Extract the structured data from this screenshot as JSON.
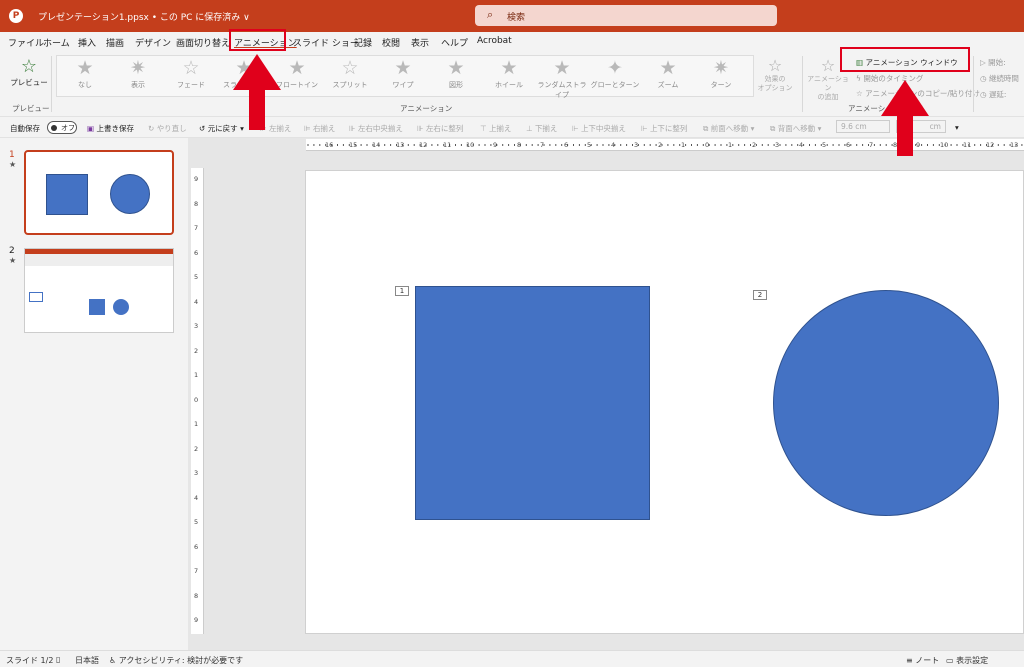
{
  "titlebar": {
    "filename": "プレゼンテーション1.ppsx • この PC に保存済み ∨",
    "search_placeholder": "検索"
  },
  "tabs": [
    "ファイル",
    "ホーム",
    "挿入",
    "描画",
    "デザイン",
    "画面切り替え",
    "アニメーション",
    "スライド ショー",
    "記録",
    "校閲",
    "表示",
    "ヘルプ",
    "Acrobat"
  ],
  "active_tab": "アニメーション",
  "ribbon": {
    "preview_button": "プレビュー",
    "preview_group": "プレビュー",
    "animation_group": "アニメーション",
    "advanced_group": "アニメーションの設定",
    "animations": [
      "なし",
      "表示",
      "フェード",
      "スライドイン",
      "フロートイン",
      "スプリット",
      "ワイプ",
      "図形",
      "ホイール",
      "ランダムストライプ",
      "グローとターン",
      "ズーム",
      "ターン"
    ],
    "effect_options": "効果の\nオプション",
    "add_animation": "アニメーション\nの追加",
    "animation_window": "アニメーション ウィンドウ",
    "trigger": "開始のタイミング",
    "animation_painter": "アニメーションのコピー/貼り付け",
    "start_label": "開始:",
    "duration_label": "継続時間",
    "delay_label": "遅延:"
  },
  "qat": {
    "autosave": "自動保存",
    "autosave_state": "オフ",
    "save": "上書き保存",
    "undo": "やり直し",
    "redo": "元に戻す",
    "align_left": "左揃え",
    "align_right": "右揃え",
    "align_center_h": "左右中央揃え",
    "distribute_h": "左右に整列",
    "align_top": "上揃え",
    "align_bottom": "下揃え",
    "align_center_v": "上下中央揃え",
    "distribute_v": "上下に整列",
    "bring_forward": "前面へ移動",
    "send_backward": "背面へ移動",
    "width": "9.6 cm",
    "height": "cm"
  },
  "thumbs": [
    {
      "num": "1",
      "star": "★"
    },
    {
      "num": "2",
      "star": "★"
    }
  ],
  "slide": {
    "tag1": "1",
    "tag2": "2"
  },
  "colors": {
    "brand": "#c43e1c",
    "shape_fill": "#4472c4",
    "shape_stroke": "#2f528f",
    "annotation_red": "#e0001b"
  },
  "hruler": [
    "16",
    "15",
    "14",
    "13",
    "12",
    "11",
    "10",
    "9",
    "8",
    "7",
    "6",
    "5",
    "4",
    "3",
    "2",
    "1",
    "0",
    "1",
    "2",
    "3",
    "4",
    "5",
    "6",
    "7",
    "8",
    "9",
    "10",
    "11",
    "12",
    "13",
    "14",
    "15",
    "16"
  ],
  "vruler": [
    "9",
    "8",
    "7",
    "6",
    "5",
    "4",
    "3",
    "2",
    "1",
    "0",
    "1",
    "2",
    "3",
    "4",
    "5",
    "6",
    "7",
    "8",
    "9"
  ],
  "statusbar": {
    "slide_info": "スライド 1/2",
    "language": "日本語",
    "accessibility": "アクセシビリティ: 検討が必要です",
    "notes": "ノート",
    "display_settings": "表示設定"
  }
}
